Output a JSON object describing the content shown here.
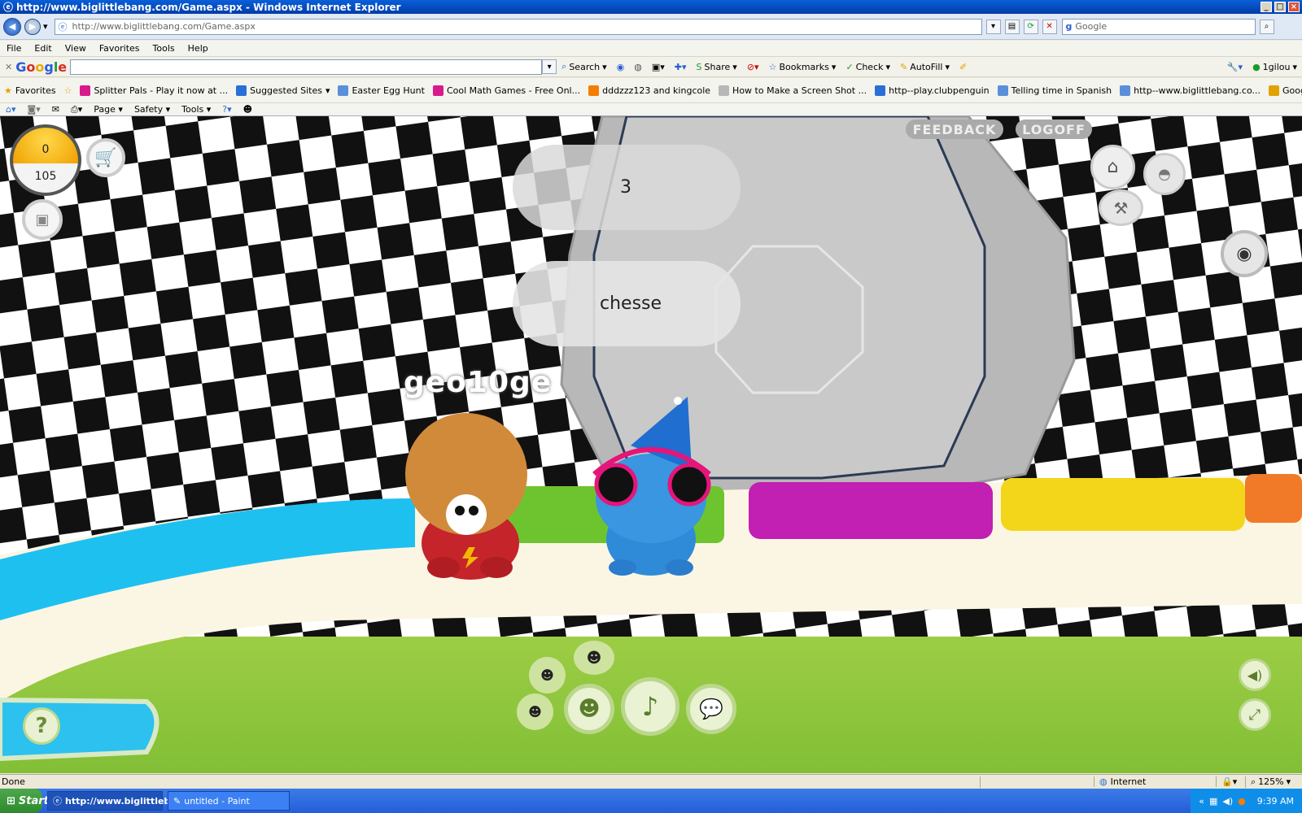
{
  "window": {
    "title": "http://www.biglittlebang.com/Game.aspx - Windows Internet Explorer"
  },
  "address": {
    "url": "http://www.biglittlebang.com/Game.aspx",
    "search_placeholder": "Google"
  },
  "menu": [
    "File",
    "Edit",
    "View",
    "Favorites",
    "Tools",
    "Help"
  ],
  "google_toolbar": {
    "logo": "Google",
    "items": [
      "Search",
      "Share",
      "Bookmarks",
      "Check",
      "AutoFill"
    ],
    "account": "1gilou"
  },
  "favorites": {
    "label": "Favorites",
    "items": [
      "Splitter Pals - Play it now at ...",
      "Suggested Sites",
      "Easter Egg Hunt",
      "Cool Math Games - Free Onl...",
      "dddzzz123 and kingcole",
      "How to Make a Screen Shot ...",
      "http--play.clubpenguin",
      "Telling time in Spanish",
      "http--www.biglittlebang.co...",
      "Google Accounts"
    ]
  },
  "command_bar": [
    "Page",
    "Safety",
    "Tools"
  ],
  "game": {
    "coins": "0",
    "score": "105",
    "feedback_label": "FEEDBACK",
    "logoff_label": "LOGOFF",
    "bubble_1": "3",
    "bubble_2": "chesse",
    "player_name": "geo10ge",
    "help_label": "?"
  },
  "status": {
    "text": "Done",
    "zone": "Internet",
    "zoom": "125%"
  },
  "taskbar": {
    "start": "Start",
    "tasks": [
      "http://www.biglittleb...",
      "untitled - Paint"
    ],
    "time": "9:39 AM"
  },
  "colors": {
    "ie_blue": "#0a5fd8",
    "track_blue": "#1ec0f0",
    "track_green": "#6dc42f",
    "track_magenta": "#c21fb3",
    "track_yellow": "#f3d61a",
    "grass": "#8cc63f"
  }
}
